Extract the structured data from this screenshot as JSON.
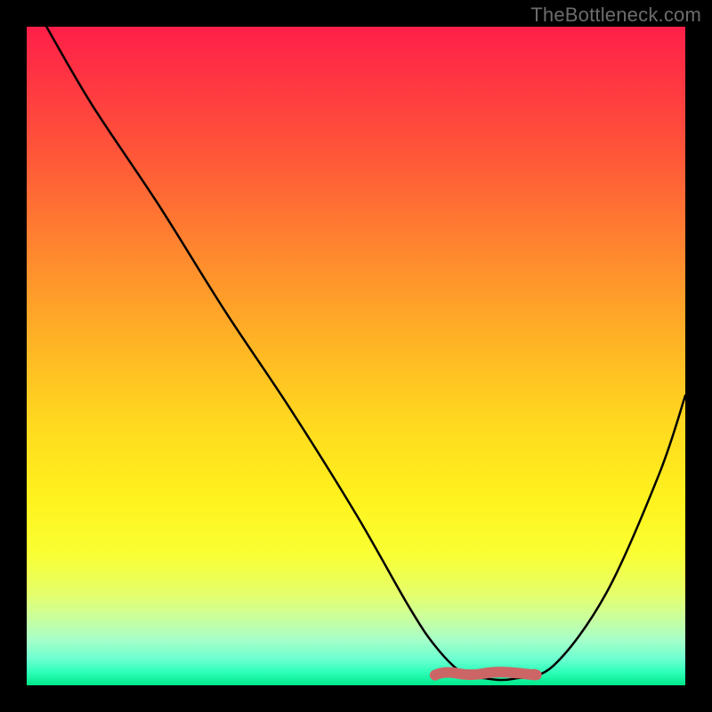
{
  "watermark": "TheBottleneck.com",
  "chart_data": {
    "type": "line",
    "title": "",
    "xlabel": "",
    "ylabel": "",
    "xlim": [
      0,
      100
    ],
    "ylim": [
      0,
      100
    ],
    "series": [
      {
        "name": "bottleneck-curve",
        "x": [
          3,
          10,
          20,
          30,
          40,
          50,
          58,
          62,
          66,
          70,
          74,
          80,
          88,
          96,
          100
        ],
        "y": [
          100,
          88,
          73,
          57,
          42,
          26,
          12,
          6,
          2,
          1,
          1,
          3,
          14,
          32,
          44
        ]
      }
    ],
    "annotations": [
      {
        "name": "optimal-zone",
        "x_start": 62,
        "x_end": 77,
        "y": 1
      }
    ],
    "gradient_stops": [
      {
        "pos": 0,
        "color": "#ff1f49"
      },
      {
        "pos": 6,
        "color": "#ff3044"
      },
      {
        "pos": 20,
        "color": "#ff5838"
      },
      {
        "pos": 35,
        "color": "#ff8a2e"
      },
      {
        "pos": 48,
        "color": "#ffb425"
      },
      {
        "pos": 60,
        "color": "#ffd81f"
      },
      {
        "pos": 72,
        "color": "#fff31e"
      },
      {
        "pos": 80,
        "color": "#faff33"
      },
      {
        "pos": 86,
        "color": "#e6ff6a"
      },
      {
        "pos": 90,
        "color": "#c8ffa0"
      },
      {
        "pos": 93,
        "color": "#a8ffc8"
      },
      {
        "pos": 96,
        "color": "#6cffd0"
      },
      {
        "pos": 98,
        "color": "#2effb9"
      },
      {
        "pos": 100,
        "color": "#00e88a"
      }
    ]
  }
}
